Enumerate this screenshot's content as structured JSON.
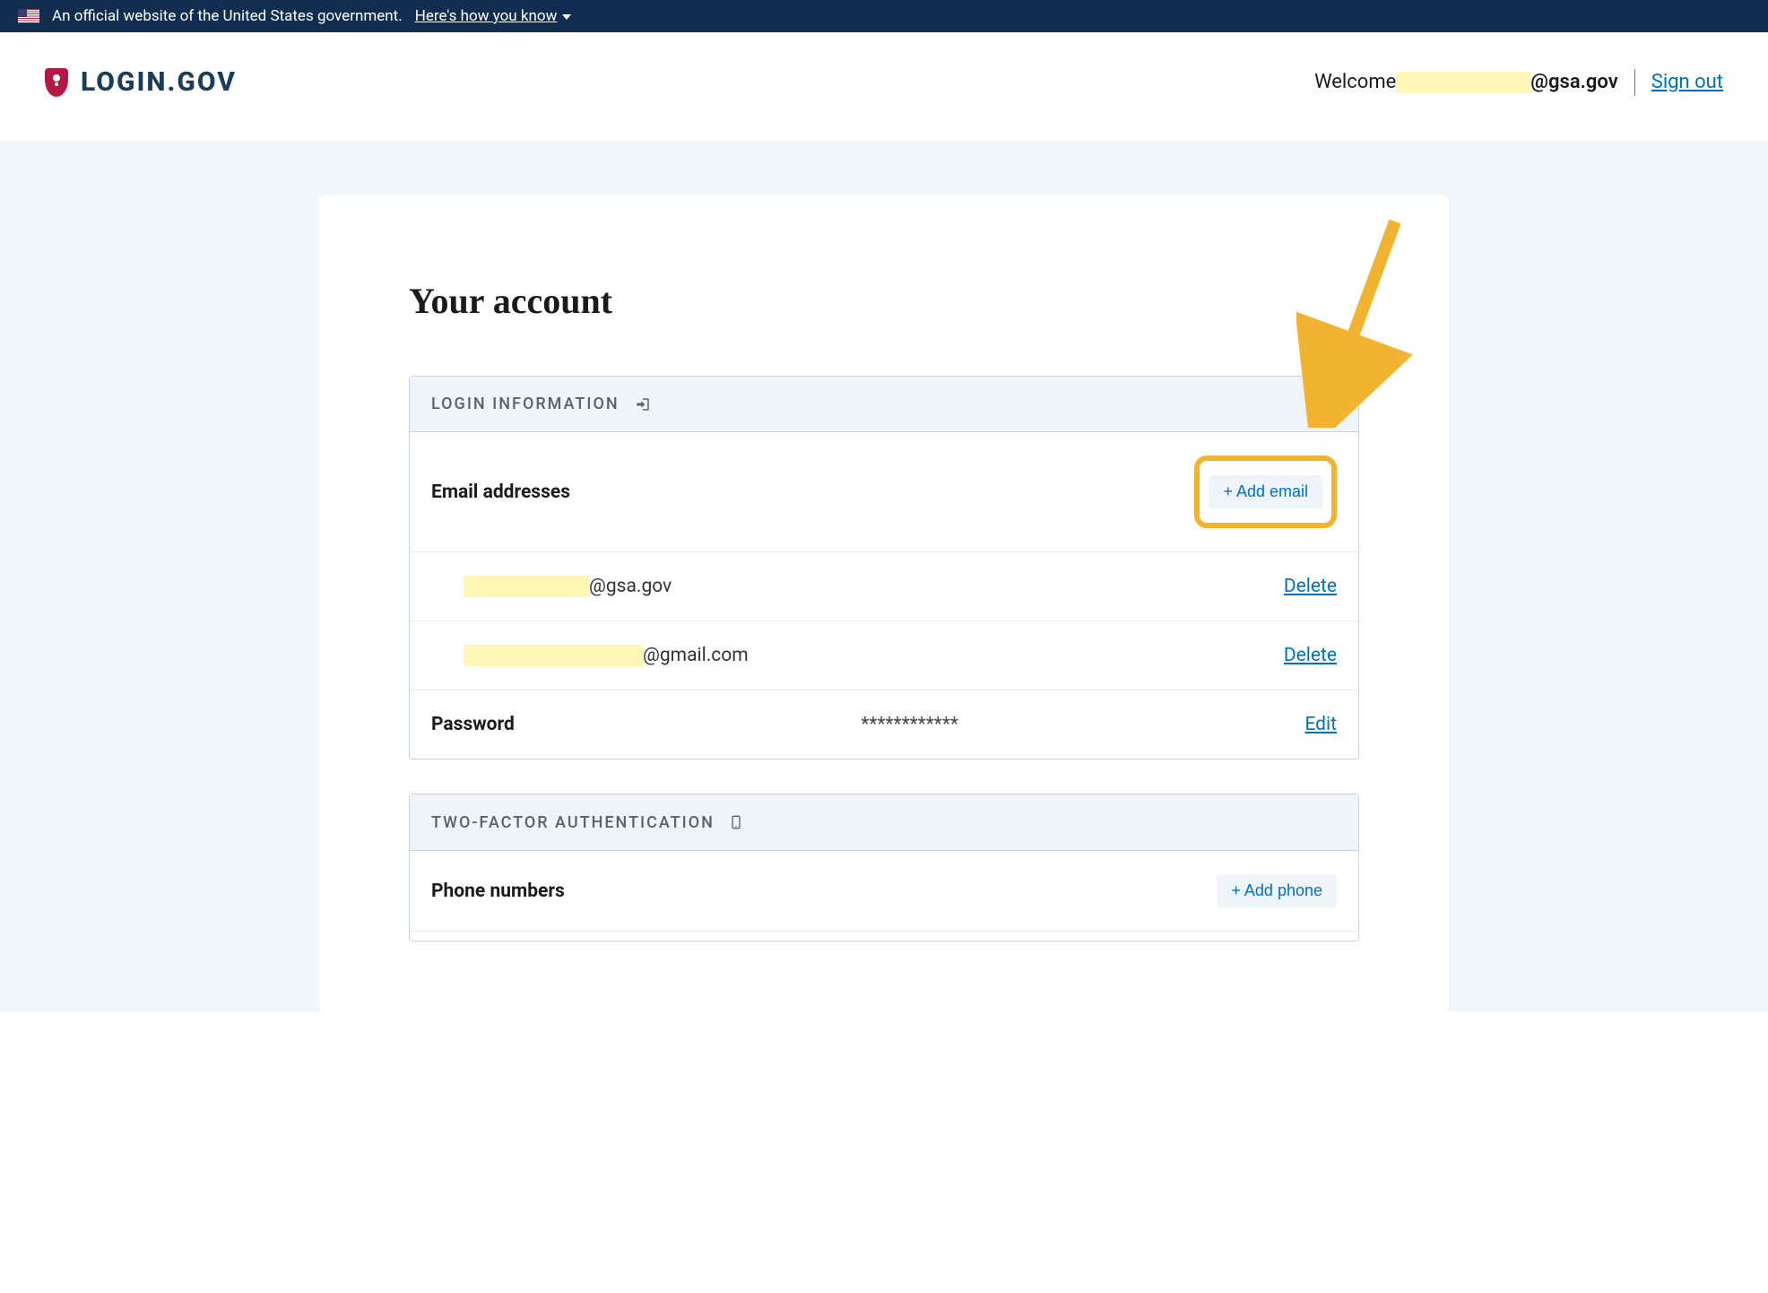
{
  "banner": {
    "text": "An official website of the United States government.",
    "how_link": "Here's how you know"
  },
  "header": {
    "logo_text": "LOGIN.GOV",
    "welcome_prefix": "Welcome",
    "welcome_domain": "@gsa.gov",
    "sign_out": "Sign out"
  },
  "page": {
    "title": "Your account"
  },
  "login_panel": {
    "heading": "LOGIN INFORMATION",
    "emails_label": "Email addresses",
    "add_email": "+ Add email",
    "emails": [
      {
        "domain": "@gsa.gov",
        "action": "Delete"
      },
      {
        "domain": "@gmail.com",
        "action": "Delete"
      }
    ],
    "password_label": "Password",
    "password_mask": "************",
    "password_action": "Edit"
  },
  "tfa_panel": {
    "heading": "TWO-FACTOR AUTHENTICATION",
    "phones_label": "Phone numbers",
    "add_phone": "+ Add phone"
  }
}
